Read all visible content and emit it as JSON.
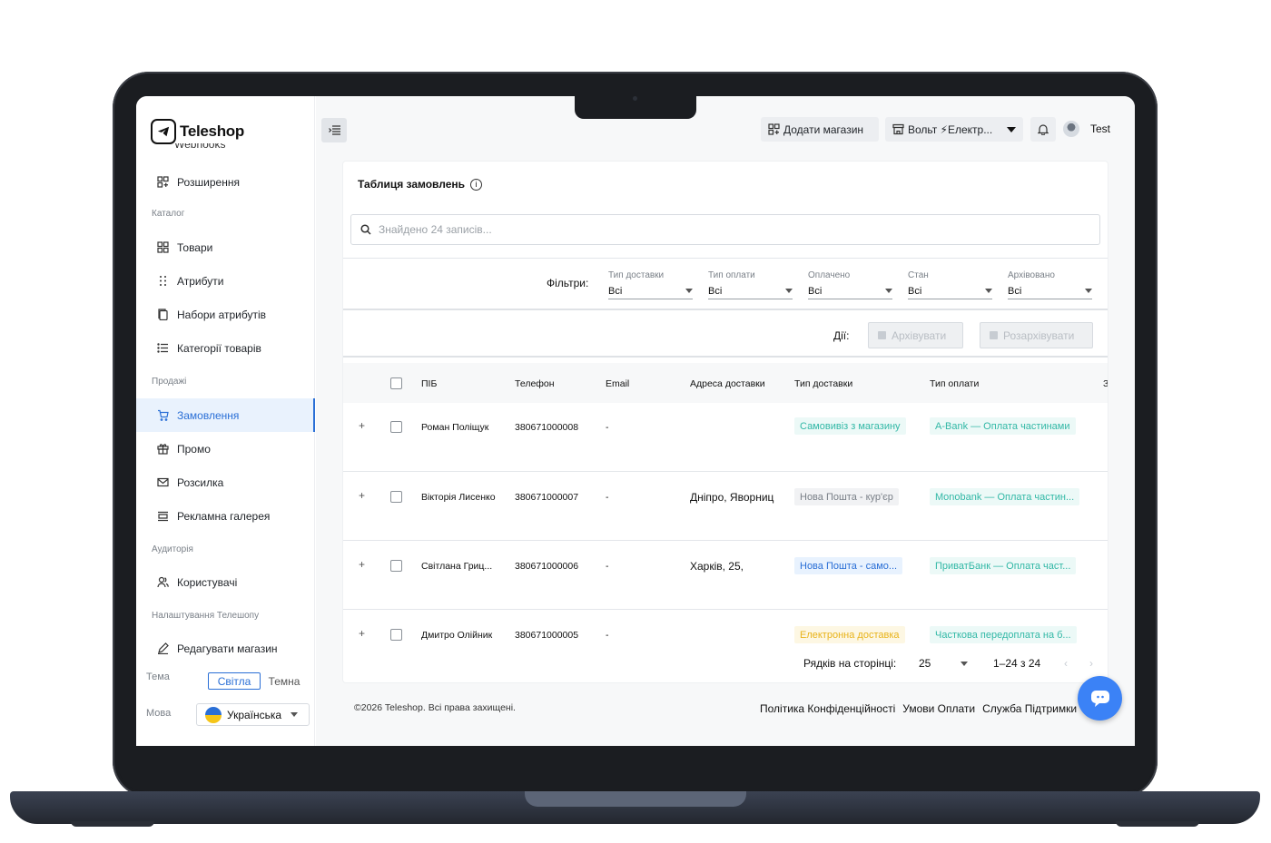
{
  "app": {
    "name": "Teleshop"
  },
  "sidebar": {
    "cut_item": "Webhooks",
    "items_top": [
      {
        "label": "Розширення",
        "icon": "extensions-icon"
      }
    ],
    "sections": {
      "catalog": "Каталог",
      "sales": "Продажі",
      "audience": "Аудиторія",
      "settings": "Налаштування Телешопу"
    },
    "catalog_items": [
      {
        "label": "Товари",
        "icon": "grid-icon"
      },
      {
        "label": "Атрибути",
        "icon": "dots-icon"
      },
      {
        "label": "Набори атрибутів",
        "icon": "copy-icon"
      },
      {
        "label": "Категорії товарів",
        "icon": "list-icon"
      }
    ],
    "sales_items": [
      {
        "label": "Замовлення",
        "icon": "cart-icon",
        "active": true
      },
      {
        "label": "Промо",
        "icon": "gift-icon"
      },
      {
        "label": "Розсилка",
        "icon": "mail-icon"
      },
      {
        "label": "Рекламна галерея",
        "icon": "gallery-icon"
      }
    ],
    "audience_items": [
      {
        "label": "Користувачі",
        "icon": "users-icon"
      }
    ],
    "settings_items": [
      {
        "label": "Редагувати магазин",
        "icon": "edit-icon"
      }
    ],
    "theme_label": "Тема",
    "theme_light": "Світла",
    "theme_dark": "Темна",
    "lang_label": "Мова",
    "lang_value": "Українська"
  },
  "topbar": {
    "add_store": "Додати магазин",
    "store_name": "Вольт ⚡Електр...",
    "user_name": "Test"
  },
  "orders": {
    "title": "Таблиця замовлень",
    "search_placeholder": "Знайдено 24 записів...",
    "filters_label": "Фільтри:",
    "filters": [
      {
        "label": "Тип доставки",
        "value": "Всі"
      },
      {
        "label": "Тип оплати",
        "value": "Всі"
      },
      {
        "label": "Оплачено",
        "value": "Всі"
      },
      {
        "label": "Стан",
        "value": "Всі"
      },
      {
        "label": "Архівовано",
        "value": "Всі"
      }
    ],
    "actions_label": "Дії:",
    "archive_btn": "Архівувати",
    "unarchive_btn": "Розархівувати",
    "columns": [
      "ПІБ",
      "Телефон",
      "Email",
      "Адреса доставки",
      "Тип доставки",
      "Тип оплати",
      "З"
    ],
    "rows": [
      {
        "name": "Роман Поліщук",
        "phone": "380671000008",
        "email": "-",
        "address": "",
        "delivery": "Самовивіз з магазину",
        "payment": "A-Bank — Оплата частинами"
      },
      {
        "name": "Вікторія Лисенко",
        "phone": "380671000007",
        "email": "-",
        "address": "Дніпро, Яворниц",
        "delivery": "Нова Пошта - кур'єр",
        "payment": "Monobank — Оплата частин..."
      },
      {
        "name": "Світлана Гриц...",
        "phone": "380671000006",
        "email": "-",
        "address": "Харків, 25,",
        "delivery": "Нова Пошта - само...",
        "payment": "ПриватБанк — Оплата част..."
      },
      {
        "name": "Дмитро Олійник",
        "phone": "380671000005",
        "email": "-",
        "address": "",
        "delivery": "Електронна доставка",
        "payment": "Часткова передоплата на б..."
      }
    ],
    "rows_per_page_label": "Рядків на сторінці:",
    "rows_per_page": "25",
    "range": "1–24 з 24"
  },
  "footer": {
    "copyright": "©2026 Teleshop. Всі права захищені.",
    "links": [
      "Політика Конфіденційності",
      "Умови Оплати",
      "Служба Підтримки"
    ]
  }
}
